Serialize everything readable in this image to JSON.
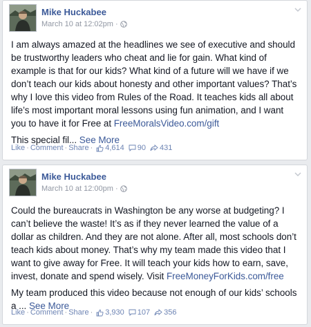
{
  "posts": [
    {
      "author": "Mike Huckabee",
      "timestamp": "March 10 at 12:02pm",
      "privacy_icon": "globe-icon",
      "text_main": "I am always amazed at the headlines we see of executive and should be trustworthy leaders who cheat and lie for gain. What kind of example is that for our kids? What kind of a future will we have if we don’t teach our kids about honesty and other important values? That’s why I love this video from Rules of the Road. It teaches kids all about life’s most important moral lessons using fun animation, and I want you to have it for Free at ",
      "link_text": "FreeMoralsVideo.com/gift",
      "text_more": "This special fil... ",
      "see_more": "See More",
      "like_label": "Like",
      "comment_label": "Comment",
      "share_label": "Share",
      "likes": "4,614",
      "comments": "90",
      "shares": "431"
    },
    {
      "author": "Mike Huckabee",
      "timestamp": "March 10 at 12:00pm",
      "privacy_icon": "globe-icon",
      "text_main": "Could the bureaucrats in Washington be any worse at budgeting? I can’t believe the waste! It’s as if they never learned the value of a dollar as children. And they are not alone. After all, most schools don’t teach kids about money. That’s why my team made this video that I want to give away for Free. It will teach your kids how to earn, save, invest, donate and spend wisely. Visit ",
      "link_text": "FreeMoneyForKids.com/free",
      "text_more": "My team produced this video because not enough of our kids’ schools a ... ",
      "see_more": "See More",
      "like_label": "Like",
      "comment_label": "Comment",
      "share_label": "Share",
      "likes": "3,930",
      "comments": "107",
      "shares": "356"
    }
  ],
  "colors": {
    "link": "#3b5998",
    "meta": "#9197a3",
    "action": "#6d84b4",
    "background": "#e9ebee"
  }
}
